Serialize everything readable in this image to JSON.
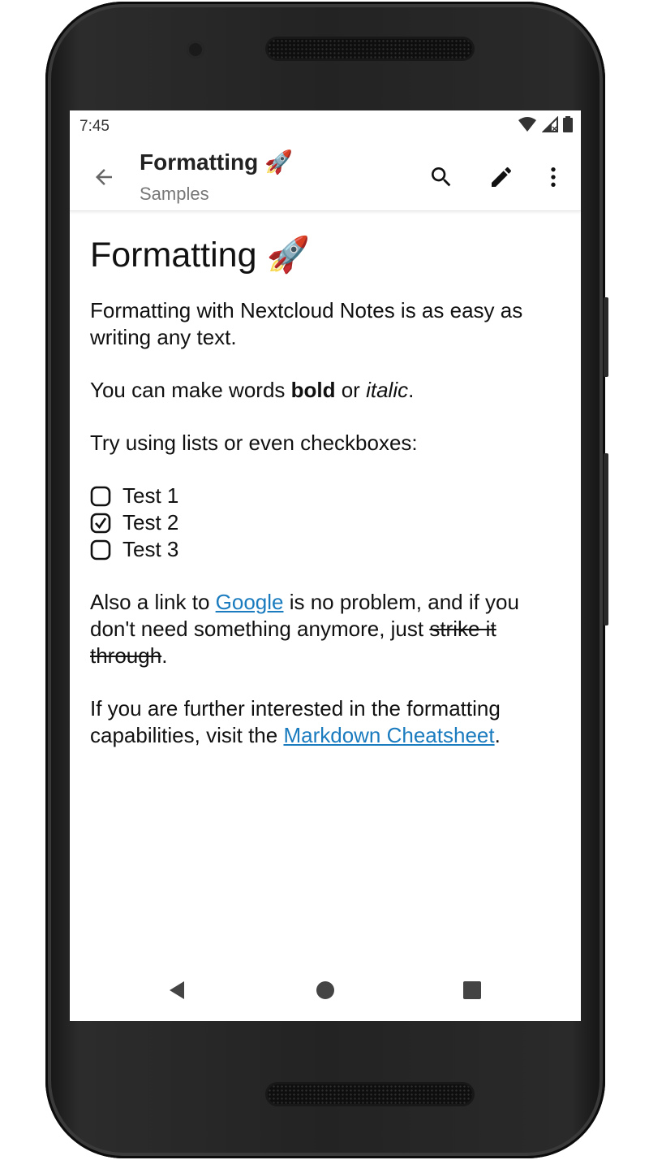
{
  "status_bar": {
    "time": "7:45"
  },
  "app_bar": {
    "title": "Formatting 🚀",
    "subtitle": "Samples",
    "actions": [
      "back-arrow-icon",
      "search-icon",
      "pencil-icon",
      "more-vert-icon"
    ]
  },
  "note": {
    "heading": "Formatting 🚀",
    "para1": "Formatting with Nextcloud Notes is as easy as writing any text.",
    "para2": {
      "before": "You can make words ",
      "bold": "bold",
      "middle": " or ",
      "italic": "italic",
      "after": "."
    },
    "para3": "Try using lists or even checkboxes:",
    "checkboxes": [
      {
        "label": "Test 1",
        "checked": false
      },
      {
        "label": "Test 2",
        "checked": true
      },
      {
        "label": "Test 3",
        "checked": false
      }
    ],
    "para4": {
      "before": "Also a link to ",
      "link": "Google",
      "middle": " is no problem, and if you don't need something anymore, just ",
      "strike": "strike it through",
      "after": "."
    },
    "para5": {
      "before": "If you are further interested in the formatting capabilities, visit the ",
      "link": "Markdown Cheatsheet",
      "after": "."
    }
  },
  "nav_bar": {
    "buttons": [
      "back-triangle-icon",
      "home-circle-icon",
      "recents-square-icon"
    ]
  },
  "colors": {
    "link": "#1a7bbf",
    "text": "#111111",
    "subtitle": "#777777",
    "frame": "#232323"
  }
}
